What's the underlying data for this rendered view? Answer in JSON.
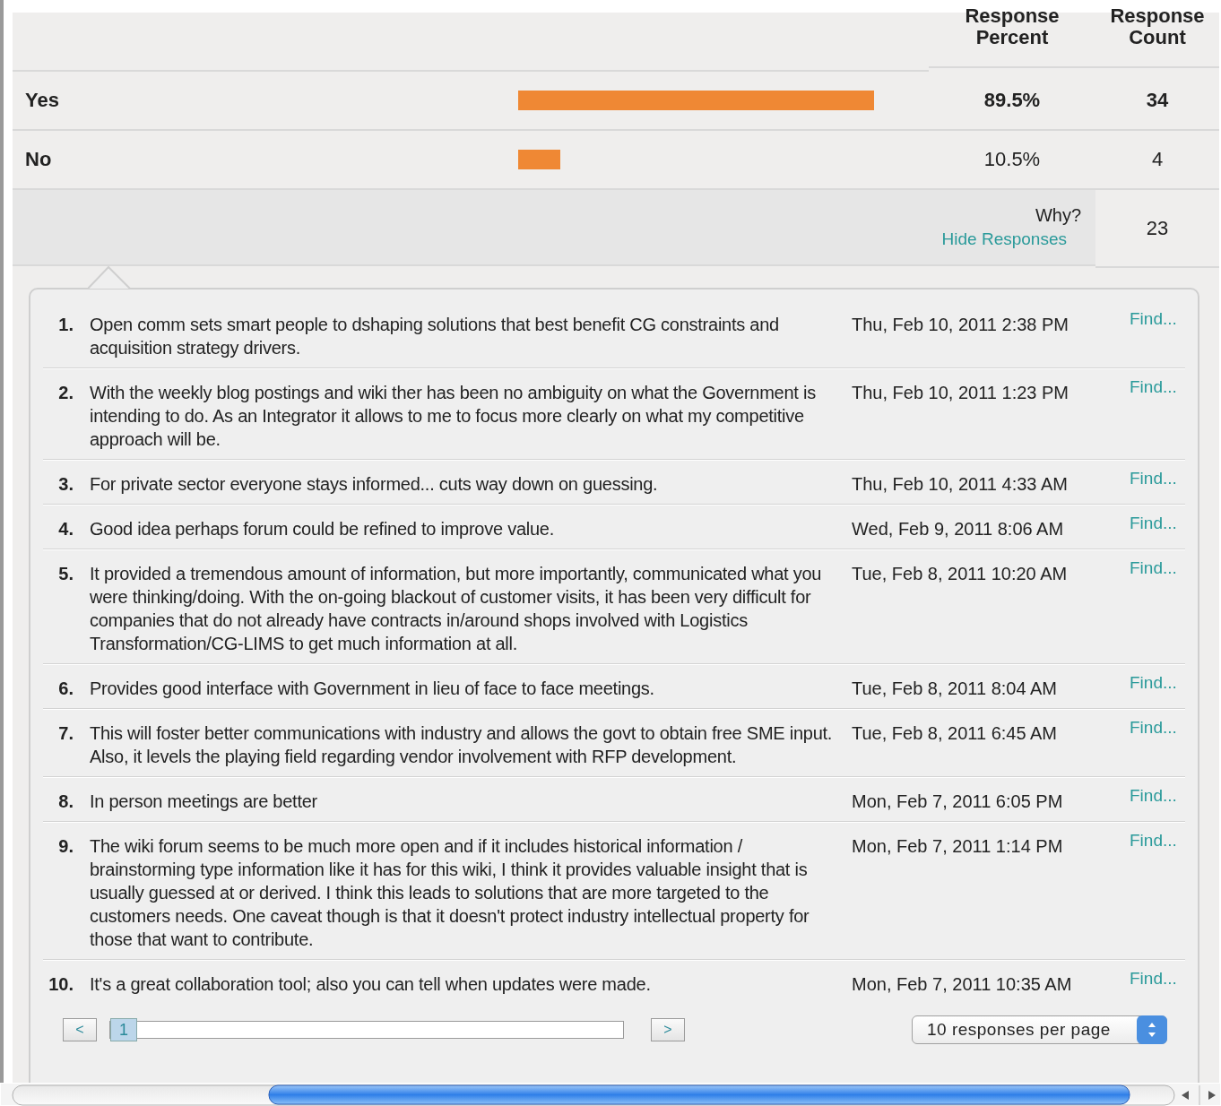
{
  "header": {
    "columns": [
      "Response Percent",
      "Response Count"
    ]
  },
  "answers": [
    {
      "label": "Yes",
      "level": 0.895,
      "percent": "89.5%",
      "count": "34",
      "emphasized": true
    },
    {
      "label": "No",
      "level": 0.105,
      "percent": "10.5%",
      "count": "4",
      "emphasized": false
    }
  ],
  "open_ended": {
    "label": "Why?",
    "link": "Hide Responses",
    "count": "23"
  },
  "responses": [
    {
      "number": "1.",
      "text": "Open comm sets smart people to dshaping solutions that best benefit CG constraints and acquisition strategy drivers.",
      "date": "Thu, Feb 10, 2011 2:38 PM",
      "action": "Find..."
    },
    {
      "number": "2.",
      "text": "With the weekly blog postings and wiki ther has been no ambiguity on what the Government is intending to do. As an Integrator it allows to me to focus more clearly on what my competitive approach will be.",
      "date": "Thu, Feb 10, 2011 1:23 PM",
      "action": "Find..."
    },
    {
      "number": "3.",
      "text": "For private sector everyone stays informed... cuts way down on guessing.",
      "date": "Thu, Feb 10, 2011 4:33 AM",
      "action": "Find..."
    },
    {
      "number": "4.",
      "text": "Good idea perhaps forum could be refined to improve value.",
      "date": "Wed, Feb 9, 2011 8:06 AM",
      "action": "Find..."
    },
    {
      "number": "5.",
      "text": "It provided a tremendous amount of information, but more importantly, communicated what you were thinking/doing. With the on-going blackout of customer visits, it has been very difficult for companies that do not already have contracts in/around shops involved with Logistics Transformation/CG-LIMS to get much information at all.",
      "date": "Tue, Feb 8, 2011 10:20 AM",
      "action": "Find..."
    },
    {
      "number": "6.",
      "text": "Provides good interface with Government in lieu of face to face meetings.",
      "date": "Tue, Feb 8, 2011 8:04 AM",
      "action": "Find..."
    },
    {
      "number": "7.",
      "text": "This will foster better communications with industry and allows the govt to obtain free SME input. Also, it levels the playing field regarding vendor involvement with RFP development.",
      "date": "Tue, Feb 8, 2011 6:45 AM",
      "action": "Find..."
    },
    {
      "number": "8.",
      "text": "In person meetings are better",
      "date": "Mon, Feb 7, 2011 6:05 PM",
      "action": "Find..."
    },
    {
      "number": "9.",
      "text": "The wiki forum seems to be much more open and if it includes historical information / brainstorming type information like it has for this wiki, I think it provides valuable insight that is usually guessed at or derived. I think this leads to solutions that are more targeted to the customers needs. One caveat though is that it doesn't protect industry intellectual property for those that want to contribute.",
      "date": "Mon, Feb 7, 2011 1:14 PM",
      "action": "Find..."
    },
    {
      "number": "10.",
      "text": "It's a great collaboration tool; also you can tell when updates were made.",
      "date": "Mon, Feb 7, 2011 10:35 AM",
      "action": "Find..."
    }
  ],
  "pager": {
    "prev": "<",
    "next": ">",
    "pages": [
      {
        "label": "1",
        "selected": true
      }
    ],
    "per_page": "10 responses per page"
  }
}
